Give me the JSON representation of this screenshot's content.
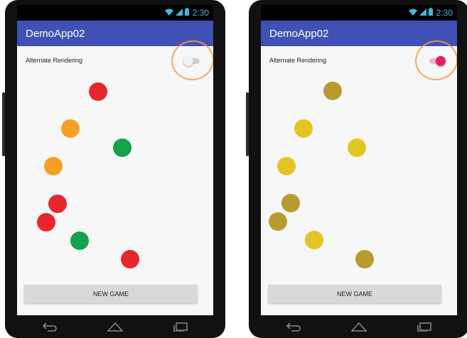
{
  "app": {
    "title": "DemoApp02",
    "status_time": "2:30"
  },
  "toggle": {
    "label": "Alternate Rendering"
  },
  "actions": {
    "new_game_label": "NEW GAME"
  },
  "colors": {
    "appbar": "#3f51b5",
    "switch_on": "#e91e63",
    "highlight": "#f39c4a"
  },
  "screens": [
    {
      "switch_state": "off",
      "balls": [
        {
          "color": "#e8262e"
        },
        {
          "color": "#f5a024"
        },
        {
          "color": "#14a34a"
        },
        {
          "color": "#f5a024"
        },
        {
          "color": "#e8262e"
        },
        {
          "color": "#e8262e"
        },
        {
          "color": "#14a34a"
        },
        {
          "color": "#e8262e"
        }
      ]
    },
    {
      "switch_state": "on",
      "balls": [
        {
          "color": "#b89a2e"
        },
        {
          "color": "#e3c424"
        },
        {
          "color": "#e3c424"
        },
        {
          "color": "#e3c424"
        },
        {
          "color": "#b89a2e"
        },
        {
          "color": "#b89a2e"
        },
        {
          "color": "#e3c424"
        },
        {
          "color": "#b89a2e"
        }
      ]
    }
  ]
}
